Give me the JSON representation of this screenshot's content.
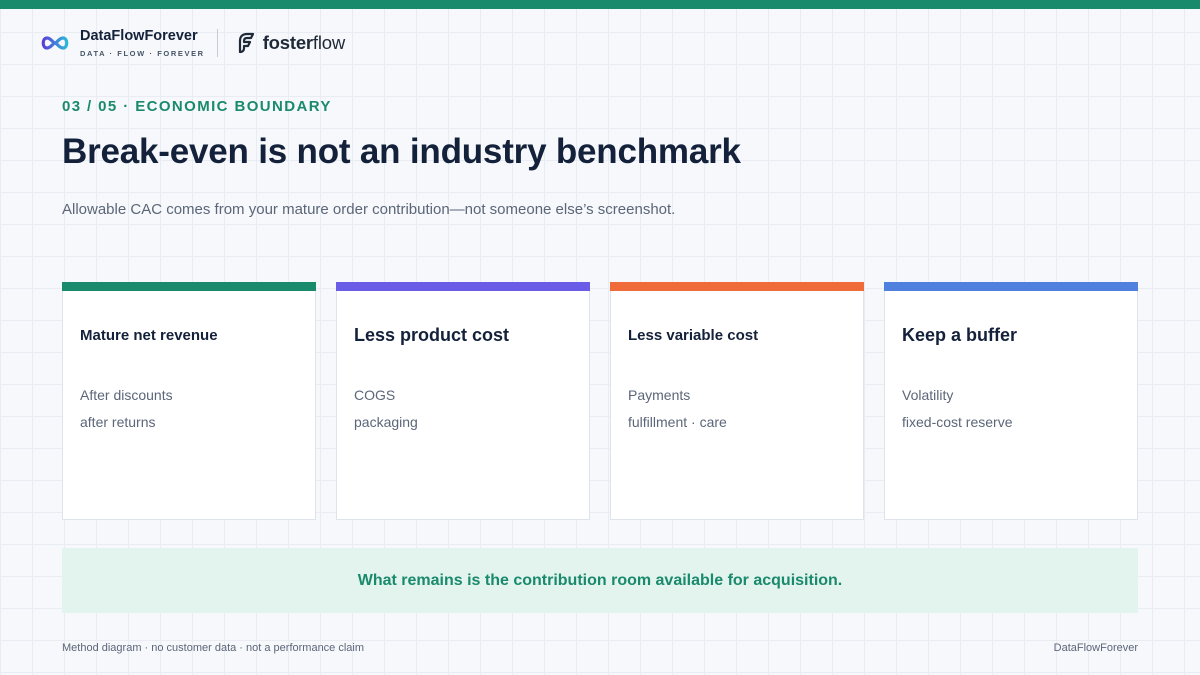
{
  "header": {
    "brand_name": "DataFlowForever",
    "brand_tagline": "DATA · FLOW · FOREVER",
    "brand_icon": "infinity-loop-icon",
    "partner_name_bold": "foster",
    "partner_name_light": "flow",
    "partner_icon": "fosterflow-f-icon"
  },
  "slide": {
    "eyebrow": "03 / 05 · ECONOMIC BOUNDARY",
    "title": "Break-even is not an industry benchmark",
    "subtitle": "Allowable CAC comes from your mature order contribution—not someone else’s screenshot."
  },
  "cards": [
    {
      "title": "Mature net revenue",
      "line1": "After discounts",
      "line2": "after returns",
      "color": "#1a8a6c"
    },
    {
      "title": "Less product cost",
      "line1": "COGS",
      "line2": "packaging",
      "color": "#6b5ce7"
    },
    {
      "title": "Less variable cost",
      "line1": "Payments",
      "line2": "fulfillment · care",
      "color": "#ef6c3a"
    },
    {
      "title": "Keep a buffer",
      "line1": "Volatility",
      "line2": "fixed-cost reserve",
      "color": "#4f80dd"
    }
  ],
  "callout": {
    "text": "What remains is the contribution room available for acquisition."
  },
  "footer": {
    "left": "Method diagram · no customer data · not a performance claim",
    "right": "DataFlowForever"
  },
  "colors": {
    "accent": "#1a8a6c",
    "topbar": "#1a8a6c",
    "callout_bg": "#e3f3ee"
  }
}
